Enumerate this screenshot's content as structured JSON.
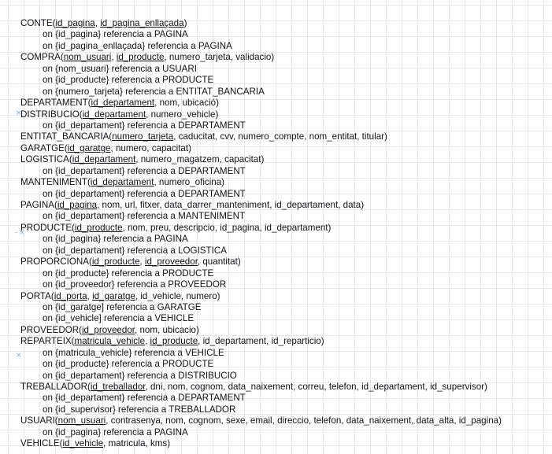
{
  "markers": [
    {
      "id": "m1",
      "glyph": "×"
    },
    {
      "id": "m2",
      "glyph": "–"
    },
    {
      "id": "m3",
      "glyph": "×"
    },
    {
      "id": "m4",
      "glyph": "×"
    }
  ],
  "lines": [
    {
      "indent": false,
      "parts": [
        {
          "t": "CONTE("
        },
        {
          "t": "id_pagina",
          "key": true
        },
        {
          "t": ", "
        },
        {
          "t": "id_pagina_enllaçada",
          "key": true
        },
        {
          "t": ")"
        }
      ]
    },
    {
      "indent": true,
      "parts": [
        {
          "t": "on {id_pagina} referencia a PAGINA"
        }
      ]
    },
    {
      "indent": true,
      "parts": [
        {
          "t": "on {id_pagina_enllaçada} referencia a PAGINA"
        }
      ]
    },
    {
      "indent": false,
      "parts": [
        {
          "t": "COMPRA("
        },
        {
          "t": "nom_usuari",
          "key": true
        },
        {
          "t": ", "
        },
        {
          "t": "id_producte",
          "key": true
        },
        {
          "t": ", numero_tarjeta, validacio)"
        }
      ]
    },
    {
      "indent": true,
      "parts": [
        {
          "t": "on {nom_usuari} referencia a USUARI"
        }
      ]
    },
    {
      "indent": true,
      "parts": [
        {
          "t": "on {id_producte} referencia a  PRODUCTE"
        }
      ]
    },
    {
      "indent": true,
      "parts": [
        {
          "t": "on {numero_tarjeta} referencia a ENTITAT_BANCARIA"
        }
      ]
    },
    {
      "indent": false,
      "parts": [
        {
          "t": "DEPARTAMENT("
        },
        {
          "t": "id_departament",
          "key": true
        },
        {
          "t": ", nom, ubicació)"
        }
      ]
    },
    {
      "indent": false,
      "parts": [
        {
          "t": "DISTRIBUCIO("
        },
        {
          "t": "id_departament",
          "key": true
        },
        {
          "t": ", numero_vehicle)"
        }
      ]
    },
    {
      "indent": true,
      "parts": [
        {
          "t": "on {id_departament} referencia a DEPARTAMENT"
        }
      ]
    },
    {
      "indent": false,
      "parts": [
        {
          "t": "ENTITAT_BANCARIA("
        },
        {
          "t": "numero_tarjeta",
          "key": true
        },
        {
          "t": ", caducitat, cvv, numero_compte, nom_entitat, titular)"
        }
      ]
    },
    {
      "indent": false,
      "parts": [
        {
          "t": "GARATGE("
        },
        {
          "t": "id_garatge",
          "key": true
        },
        {
          "t": ", numero, capacitat)"
        }
      ]
    },
    {
      "indent": false,
      "parts": [
        {
          "t": "LOGISTICA("
        },
        {
          "t": "id_departament",
          "key": true
        },
        {
          "t": ", numero_magatzem, capacitat)"
        }
      ]
    },
    {
      "indent": true,
      "parts": [
        {
          "t": "on {id_departament} referencia a DEPARTAMENT"
        }
      ]
    },
    {
      "indent": false,
      "parts": [
        {
          "t": "MANTENIMENT("
        },
        {
          "t": "id_departament",
          "key": true
        },
        {
          "t": ", numero_oficina)"
        }
      ]
    },
    {
      "indent": true,
      "parts": [
        {
          "t": "on {id_departament} referencia a DEPARTAMENT"
        }
      ]
    },
    {
      "indent": false,
      "parts": [
        {
          "t": "PAGINA("
        },
        {
          "t": "id_pagina",
          "key": true
        },
        {
          "t": ", nom, url, fitxer, data_darrer_manteniment, id_departament, data)"
        }
      ]
    },
    {
      "indent": true,
      "parts": [
        {
          "t": "on {id_departament} referencia a MANTENIMENT"
        }
      ]
    },
    {
      "indent": false,
      "parts": [
        {
          "t": "PRODUCTE("
        },
        {
          "t": "id_producte",
          "key": true
        },
        {
          "t": ", nom, preu, descripcio, id_pagina, id_departament)"
        }
      ]
    },
    {
      "indent": true,
      "parts": [
        {
          "t": "on {id_pagina} referencia a PAGINA"
        }
      ]
    },
    {
      "indent": true,
      "parts": [
        {
          "t": "on {id_departament} referencia a LOGISTICA"
        }
      ]
    },
    {
      "indent": false,
      "parts": [
        {
          "t": "PROPORCIONA("
        },
        {
          "t": "id_producte",
          "key": true
        },
        {
          "t": ", "
        },
        {
          "t": "id_proveedor",
          "key": true
        },
        {
          "t": ", quantitat)"
        }
      ]
    },
    {
      "indent": true,
      "parts": [
        {
          "t": "on {id_producte} referencia a PRODUCTE"
        }
      ]
    },
    {
      "indent": true,
      "parts": [
        {
          "t": "on {id_proveedor} referencia a PROVEEDOR"
        }
      ]
    },
    {
      "indent": false,
      "parts": [
        {
          "t": "PORTA("
        },
        {
          "t": "id_porta",
          "key": true
        },
        {
          "t": ", "
        },
        {
          "t": "id_garatge",
          "key": true
        },
        {
          "t": ", id_vehicle, numero)"
        }
      ]
    },
    {
      "indent": true,
      "parts": [
        {
          "t": "on {id_garatge] referencia a GARATGE"
        }
      ]
    },
    {
      "indent": true,
      "parts": [
        {
          "t": "on {id_vehicle] referencia a VEHICLE"
        }
      ]
    },
    {
      "indent": false,
      "parts": [
        {
          "t": "PROVEEDOR("
        },
        {
          "t": "id_proveedor",
          "key": true
        },
        {
          "t": ", nom, ubicacio)"
        }
      ]
    },
    {
      "indent": false,
      "parts": [
        {
          "t": "REPARTEIX("
        },
        {
          "t": "matricula_vehicle",
          "key": true
        },
        {
          "t": ", "
        },
        {
          "t": "id_producte",
          "key": true
        },
        {
          "t": ", id_departament, id_reparticio)"
        }
      ]
    },
    {
      "indent": true,
      "parts": [
        {
          "t": "on {matricula_vehicle} referencia a VEHICLE"
        }
      ]
    },
    {
      "indent": true,
      "parts": [
        {
          "t": "on {id_producte} referencia a PRODUCTE"
        }
      ]
    },
    {
      "indent": true,
      "parts": [
        {
          "t": "on {id_departament} referencia a DISTRIBUCIO"
        }
      ]
    },
    {
      "indent": false,
      "parts": [
        {
          "t": "TREBALLADOR("
        },
        {
          "t": "id_treballador",
          "key": true
        },
        {
          "t": ", dni, nom, cognom, data_naixement, correu, telefon,  id_departament, id_supervisor)"
        }
      ]
    },
    {
      "indent": true,
      "parts": [
        {
          "t": "on {id_departament} referencia a DEPARTAMENT"
        }
      ]
    },
    {
      "indent": true,
      "parts": [
        {
          "t": "on {id_supervisor} referencia a TREBALLADOR"
        }
      ]
    },
    {
      "indent": false,
      "parts": [
        {
          "t": "USUARI("
        },
        {
          "t": "nom_usuari",
          "key": true
        },
        {
          "t": ", contrasenya, nom, cognom, sexe, email, direccio, telefon, data_naixement, data_alta, id_pagina)"
        }
      ]
    },
    {
      "indent": true,
      "parts": [
        {
          "t": "on {id_pagina} referencia a PAGINA"
        }
      ]
    },
    {
      "indent": false,
      "parts": [
        {
          "t": "VEHICLE("
        },
        {
          "t": "id_vehicle",
          "key": true
        },
        {
          "t": ", matricula, kms)"
        }
      ]
    }
  ]
}
